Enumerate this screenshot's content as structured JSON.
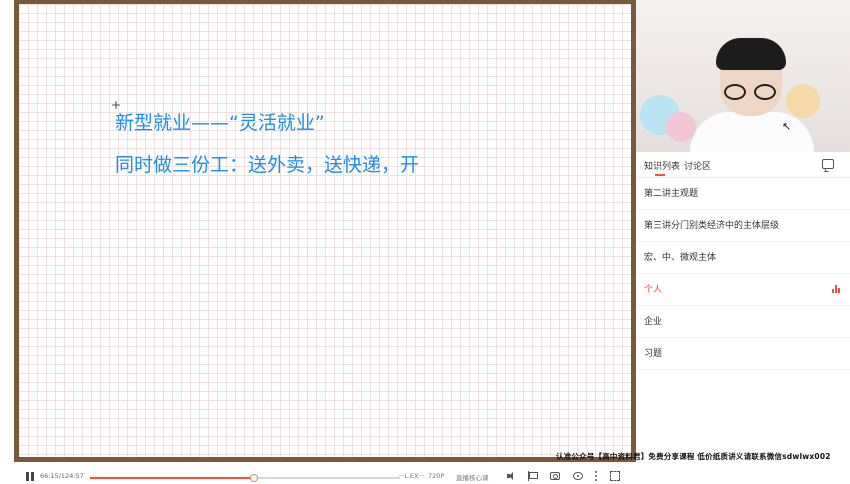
{
  "board": {
    "line1": "新型就业——“灵活就业”",
    "line2": "同时做三份工：送外卖，送快递，开"
  },
  "panel": {
    "tabs": [
      {
        "label": "知识列表",
        "active": true
      },
      {
        "label": "讨论区",
        "active": false
      }
    ],
    "items": [
      {
        "label": "第二讲主观题",
        "active": false
      },
      {
        "label": "第三讲分门别类经济中的主体层级",
        "active": false
      },
      {
        "label": "宏、中、微观主体",
        "active": false
      },
      {
        "label": "个人",
        "active": true
      },
      {
        "label": "企业",
        "active": false
      },
      {
        "label": "习题",
        "active": false
      }
    ]
  },
  "watermark": "认准公众号【高中资料君】免费分享课程 低价纸质讲义请联系微信sdwlwx002",
  "player": {
    "time": "66:15/124:57",
    "progress": 0.53,
    "speed": "···L.EX···",
    "quality": "720P",
    "mode": "直播核心课",
    "accent": "#ff4d38"
  }
}
